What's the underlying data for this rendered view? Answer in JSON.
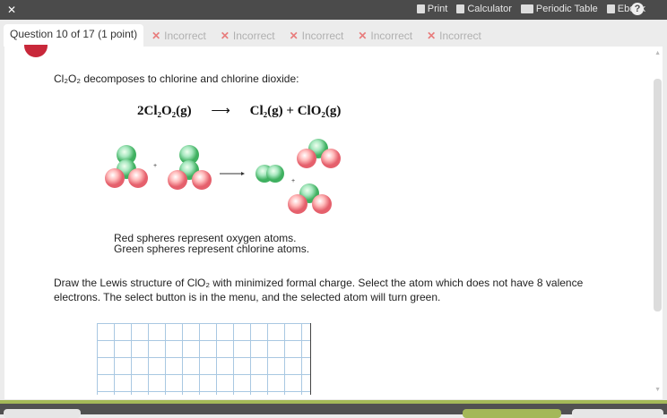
{
  "topbar": {
    "tools": [
      "Print",
      "Calculator",
      "Periodic Table",
      "Ebook"
    ],
    "help": "?"
  },
  "tabs": {
    "current": "Question 10 of 17 (1 point)",
    "others": [
      "Incorrect",
      "Incorrect",
      "Incorrect",
      "Incorrect",
      "Incorrect"
    ],
    "mark": "✕"
  },
  "question": {
    "intro": "Cl₂O₂ decomposes to chlorine and chlorine dioxide:",
    "equation": {
      "lhs": "2Cl₂O₂(g)",
      "arrow": "⟶",
      "rhs": "Cl₂(g) + ClO₂(g)"
    },
    "plus": "+",
    "caption1": "Red spheres represent oxygen atoms.",
    "caption2": "Green spheres represent chlorine atoms.",
    "instructions": "Draw the Lewis structure of ClO₂ with minimized formal charge. Select the atom which does not have 8 valence electrons. The select button is in the menu, and the selected atom will turn green."
  },
  "colors": {
    "oxygen": "#f07f86",
    "chlorine": "#7fd49a",
    "accent": "#a4b858"
  }
}
